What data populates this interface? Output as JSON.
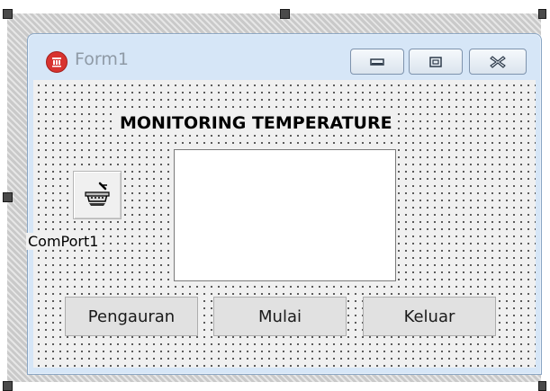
{
  "window": {
    "title": "Form1",
    "title_color": "#8f9aa6",
    "icon": "app-shield-icon",
    "controls": [
      "minimize-icon",
      "maximize-icon",
      "close-icon"
    ]
  },
  "form": {
    "heading": "MONITORING TEMPERATURE",
    "component": {
      "label": "ComPort1",
      "icon": "serial-port-icon"
    },
    "buttons": {
      "settings": "Pengauran",
      "start": "Mulai",
      "exit": "Keluar"
    }
  },
  "colors": {
    "client_background": "#f0f0f0",
    "button_background": "#e1e1e1",
    "titlebar_background": "#d6e6f7",
    "icon_red": "#d8332f"
  }
}
